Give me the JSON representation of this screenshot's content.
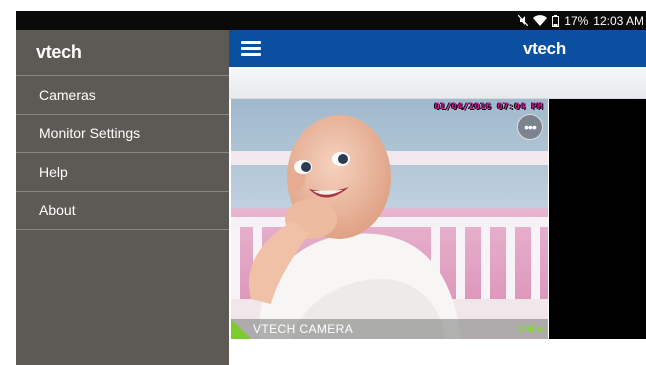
{
  "status_bar": {
    "battery": "17%",
    "time": "12:03 AM",
    "icons": [
      "mute-icon",
      "wifi-icon",
      "battery-icon"
    ]
  },
  "drawer": {
    "logo": "vtech",
    "items": [
      {
        "label": "Cameras"
      },
      {
        "label": "Monitor Settings"
      },
      {
        "label": "Help"
      },
      {
        "label": "About"
      }
    ]
  },
  "appbar": {
    "logo": "vtech",
    "menu_icon": "hamburger-icon"
  },
  "camera": {
    "timestamp": "01/04/2016 07:04 PM",
    "name": "VTECH CAMERA",
    "status": "Online",
    "more_icon": "more-icon"
  },
  "colors": {
    "appbar": "#0b4fa0",
    "drawer": "#5d5954",
    "online": "#86d635"
  }
}
